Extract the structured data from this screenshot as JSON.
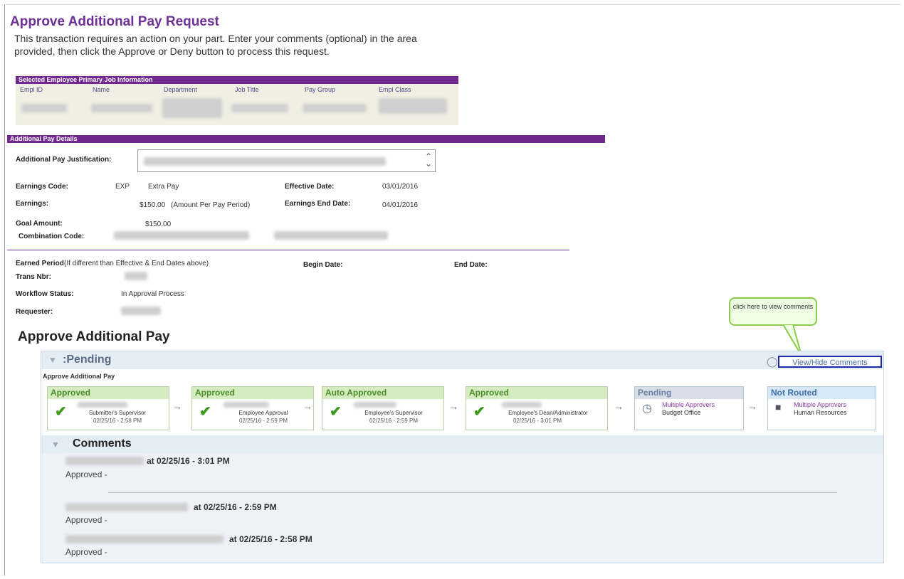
{
  "page": {
    "title": "Approve Additional Pay Request",
    "instructions": "This transaction requires an action on your part. Enter your comments (optional) in the area provided, then click the Approve or Deny button to process this request."
  },
  "primary_job": {
    "heading": "Selected Employee Primary Job Information",
    "columns": [
      "Empl ID",
      "Name",
      "Department",
      "Job Title",
      "Pay Group",
      "Empl Class"
    ]
  },
  "details": {
    "heading": "Additional Pay Details",
    "justification_label": "Additional Pay Justification:",
    "earnings_code_label": "Earnings Code:",
    "earnings_code": "EXP",
    "earnings_code_desc": "Extra Pay",
    "effective_date_label": "Effective Date:",
    "effective_date": "03/01/2016",
    "earnings_label": "Earnings:",
    "earnings": "$150.00",
    "earnings_note": "(Amount Per Pay Period)",
    "end_date_label": "Earnings End Date:",
    "end_date": "04/01/2016",
    "goal_label": "Goal Amount:",
    "goal": "$150.00",
    "combo_label": "Combination Code:",
    "earned_period_label": "Earned Period",
    "earned_period_note": "(If different than Effective & End Dates above)",
    "begin_date_label": "Begin Date:",
    "end_date2_label": "End Date:",
    "trans_label": "Trans Nbr:",
    "workflow_label": "Workflow Status:",
    "workflow": "In Approval Process",
    "requester_label": "Requester:"
  },
  "callout": "click here to view comments",
  "approval": {
    "heading": "Approve Additional Pay",
    "status": ":Pending",
    "sub": "Approve Additional Pay",
    "view_hide": "View/Hide Comments",
    "steps": [
      {
        "status": "Approved",
        "role": "Submitter's Supervisor",
        "date": "02/25/16 - 2:58 PM"
      },
      {
        "status": "Approved",
        "role": "Employee Approval",
        "date": "02/25/16 - 2:59 PM"
      },
      {
        "status": "Auto Approved",
        "role": "Employee's Supervisor",
        "date": "02/25/16 - 2:59 PM"
      },
      {
        "status": "Approved",
        "role": "Employee's Dean/Administrator",
        "date": "02/25/16 - 3:01 PM"
      },
      {
        "status": "Pending",
        "approvers": "Multiple Approvers",
        "role": "Budget Office"
      },
      {
        "status": "Not Routed",
        "approvers": "Multiple Approvers",
        "role": "Human Resources"
      }
    ],
    "comments_heading": "Comments",
    "comments": [
      {
        "at": "at 02/25/16 - 3:01 PM",
        "text": "Approved -"
      },
      {
        "at": "at 02/25/16 - 2:59 PM",
        "text": "Approved -"
      },
      {
        "at": "at 02/25/16 - 2:58 PM",
        "text": "Approved -"
      }
    ]
  },
  "colors": {
    "accent": "#6e2f96",
    "approved": "#4c8d2a",
    "link": "#4a6fa5"
  }
}
